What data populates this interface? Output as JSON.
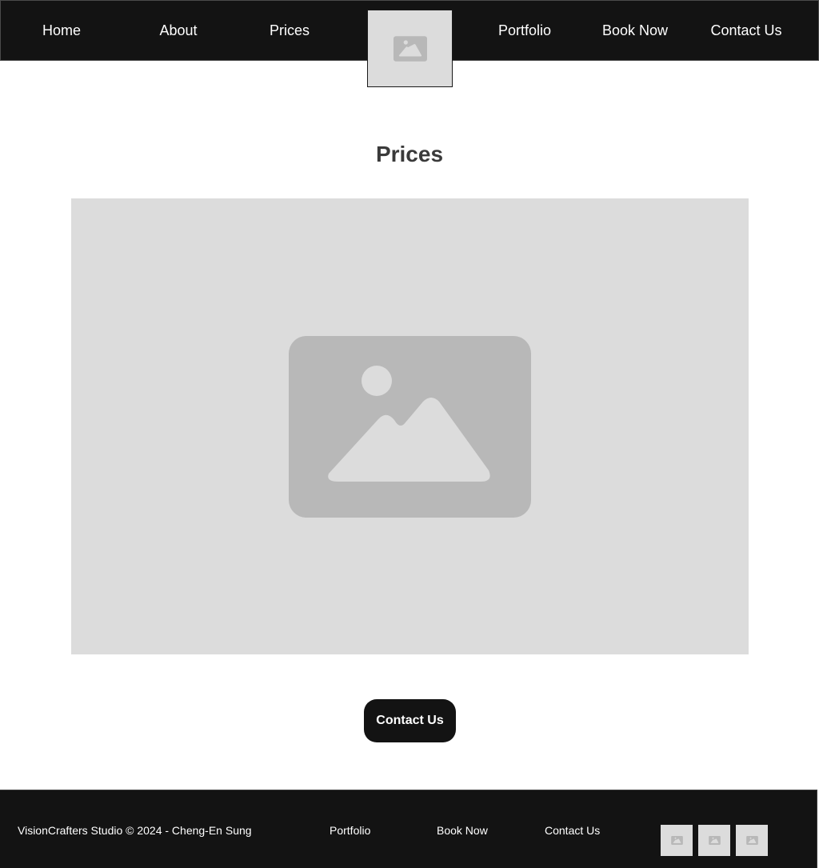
{
  "nav": {
    "links": [
      "Home",
      "About",
      "Prices",
      "Portfolio",
      "Book Now",
      "Contact Us"
    ],
    "logo_icon": "image-placeholder-icon"
  },
  "main": {
    "title": "Prices",
    "hero_icon": "image-placeholder-icon",
    "cta_label": "Contact Us"
  },
  "footer": {
    "copyright": "VisionCrafters Studio © 2024 - Cheng-En Sung",
    "links": [
      "Portfolio",
      "Book Now",
      "Contact Us"
    ],
    "social_icons": [
      "image-placeholder-icon",
      "image-placeholder-icon",
      "image-placeholder-icon"
    ]
  },
  "colors": {
    "dark": "#131313",
    "placeholder_bg": "#dcdcdc",
    "placeholder_icon": "#b8b8b8",
    "title_text": "#3a3a3a"
  }
}
